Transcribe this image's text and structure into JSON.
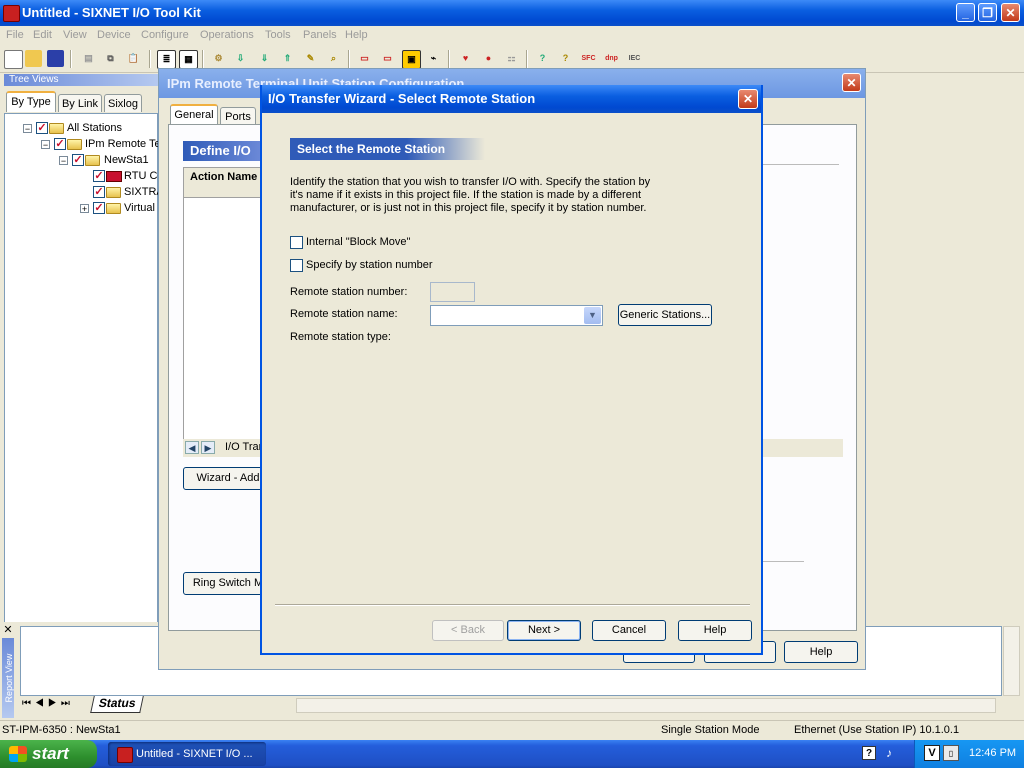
{
  "app": {
    "title": "Untitled - SIXNET I/O Tool Kit",
    "menu": [
      "File",
      "Edit",
      "View",
      "Device",
      "Configure",
      "Operations",
      "Tools",
      "Panels",
      "Help"
    ]
  },
  "tree_panel": {
    "caption": "Tree Views",
    "tabs": [
      "By Type",
      "By Link",
      "Sixlog"
    ],
    "nodes": [
      {
        "label": "All Stations"
      },
      {
        "label": "IPm Remote Te"
      },
      {
        "label": "NewSta1"
      },
      {
        "label": "RTU Co"
      },
      {
        "label": "SIXTRA"
      },
      {
        "label": "Virtual I"
      }
    ]
  },
  "rtu_dialog": {
    "title": "IPm Remote Terminal Unit Station Configuration",
    "tabs": [
      "General",
      "Ports"
    ],
    "section_header": "Define I/O",
    "column_header": "Action Name",
    "sheet_tab": "I/O Tran",
    "wizard_add_button": "Wizard - Add",
    "ring_switch_button": "Ring Switch M",
    "help_button": "Help"
  },
  "wizard": {
    "title": "I/O Transfer Wizard - Select Remote Station",
    "header": "Select the Remote Station",
    "description_lines": [
      "Identify the station that you wish to transfer I/O with. Specify the station by",
      "it's name if it exists in this project file. If the station is made by a different",
      "manufacturer, or is just not in this project file, specify it by station number."
    ],
    "internal_block_move_label": "Internal \"Block Move\"",
    "specify_by_number_label": "Specify by station number",
    "remote_station_number_label": "Remote station number:",
    "remote_station_number_value": "",
    "remote_station_name_label": "Remote station name:",
    "remote_station_name_value": "",
    "remote_station_type_label": "Remote station type:",
    "generic_stations_button": "Generic Stations...",
    "back_button": "< Back",
    "next_button": "Next >",
    "cancel_button": "Cancel",
    "help_button": "Help"
  },
  "report_panel": {
    "caption": "Report View",
    "status_tab": "Status"
  },
  "status_bar": {
    "left": "ST-IPM-6350 : NewSta1",
    "mode": "Single Station Mode",
    "connection": "Ethernet (Use Station IP) 10.1.0.1"
  },
  "taskbar": {
    "start": "start",
    "task": "Untitled - SIXNET I/O ...",
    "clock": "12:46 PM"
  }
}
